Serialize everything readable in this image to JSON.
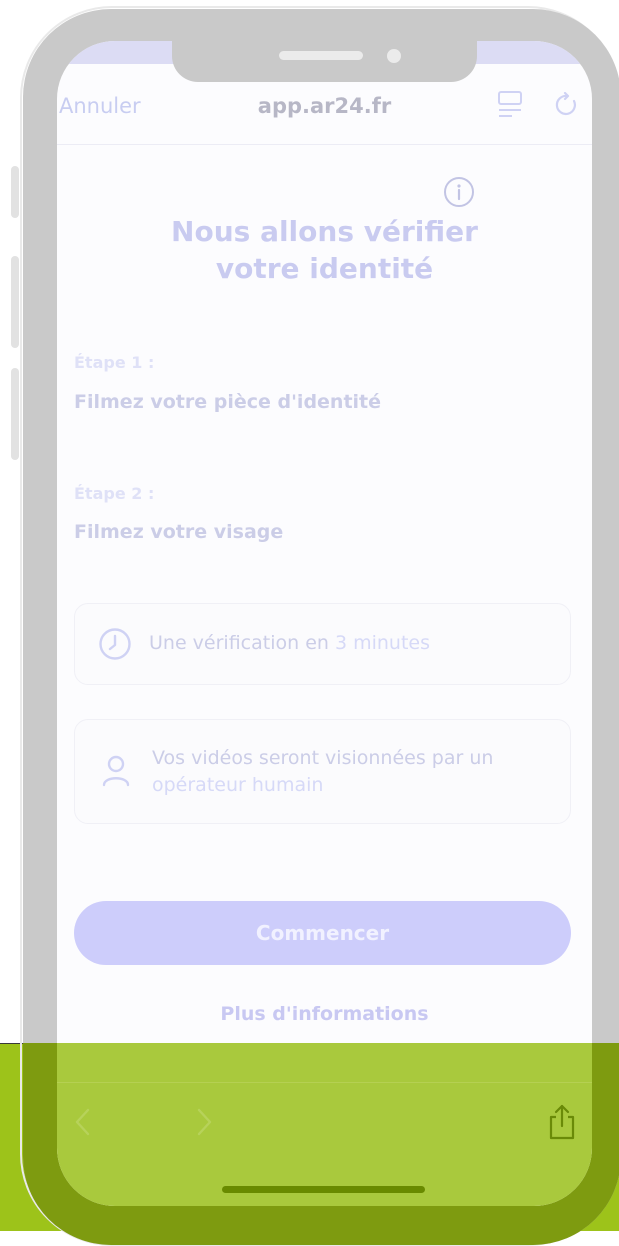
{
  "browser": {
    "cancel_label": "Annuler",
    "url": "app.ar24.fr"
  },
  "icons": {
    "reader": "reader-mode-icon",
    "reload": "reload-icon",
    "info": "info-icon",
    "clock": "clock-icon",
    "person": "person-icon",
    "back": "chevron-left-icon",
    "forward": "chevron-right-icon",
    "share": "share-icon"
  },
  "page": {
    "title_line1": "Nous allons vérifier",
    "title_line2": "votre identité",
    "steps": [
      {
        "label": "Étape 1 :",
        "text": "Filmez votre pièce d'identité"
      },
      {
        "label": "Étape 2 :",
        "text": "Filmez votre visage"
      }
    ],
    "duration_card": {
      "text": "Une vérification en ",
      "highlight": "3 minutes"
    },
    "operator_card": {
      "text": "Vos vidéos seront visionnées par un",
      "highlight": "opérateur humain"
    },
    "start_button": "Commencer",
    "more_info_link": "Plus d'informations"
  },
  "colors": {
    "accent": "#c9cbf0",
    "button": "#cdcdfb",
    "overlay_green": "#9dc31a"
  }
}
